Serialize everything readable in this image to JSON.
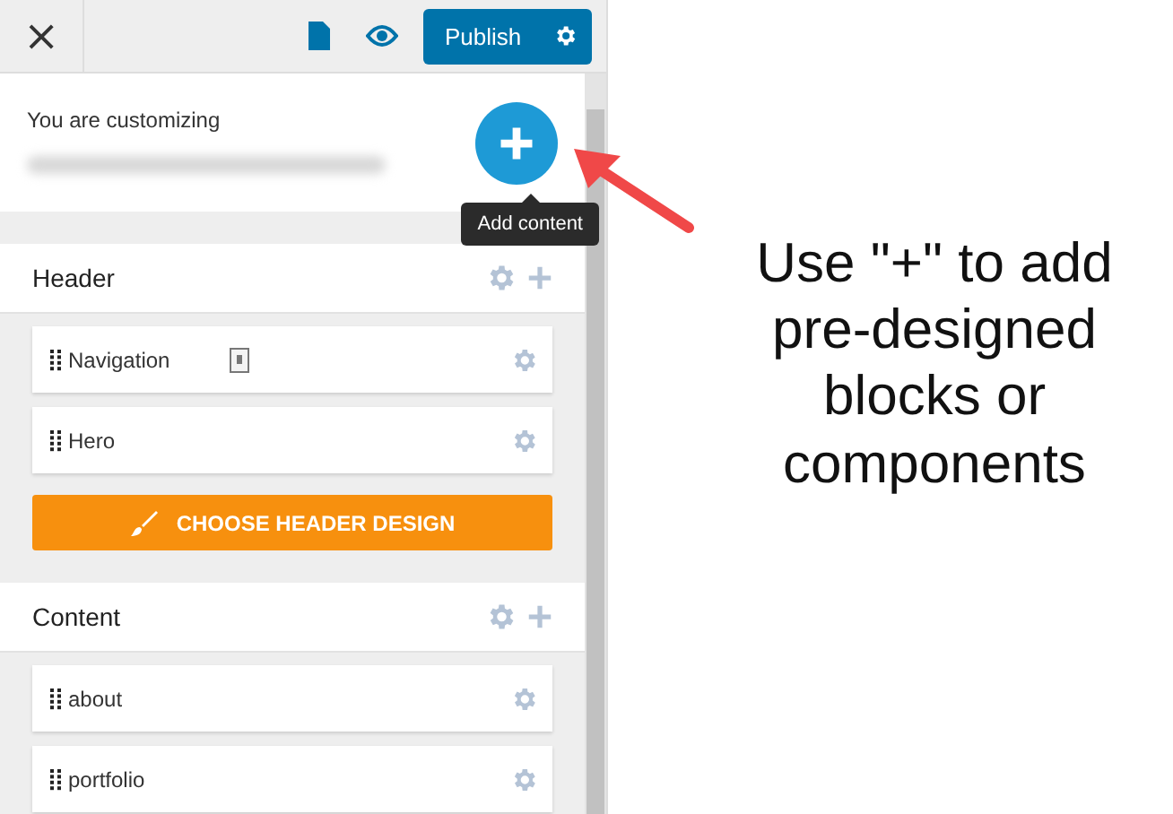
{
  "toolbar": {
    "close": "×",
    "publish": "Publish"
  },
  "intro": {
    "label": "You are customizing",
    "add_tooltip": "Add content"
  },
  "sections": [
    {
      "title": "Header",
      "items": [
        {
          "label": "Navigation",
          "card_icon": true
        },
        {
          "label": "Hero",
          "card_icon": false
        }
      ],
      "action": "CHOOSE HEADER DESIGN"
    },
    {
      "title": "Content",
      "items": [
        {
          "label": "about",
          "card_icon": false
        },
        {
          "label": "portfolio",
          "card_icon": false
        }
      ]
    }
  ],
  "callout": "Use \"+\" to add pre-designed blocks or components"
}
